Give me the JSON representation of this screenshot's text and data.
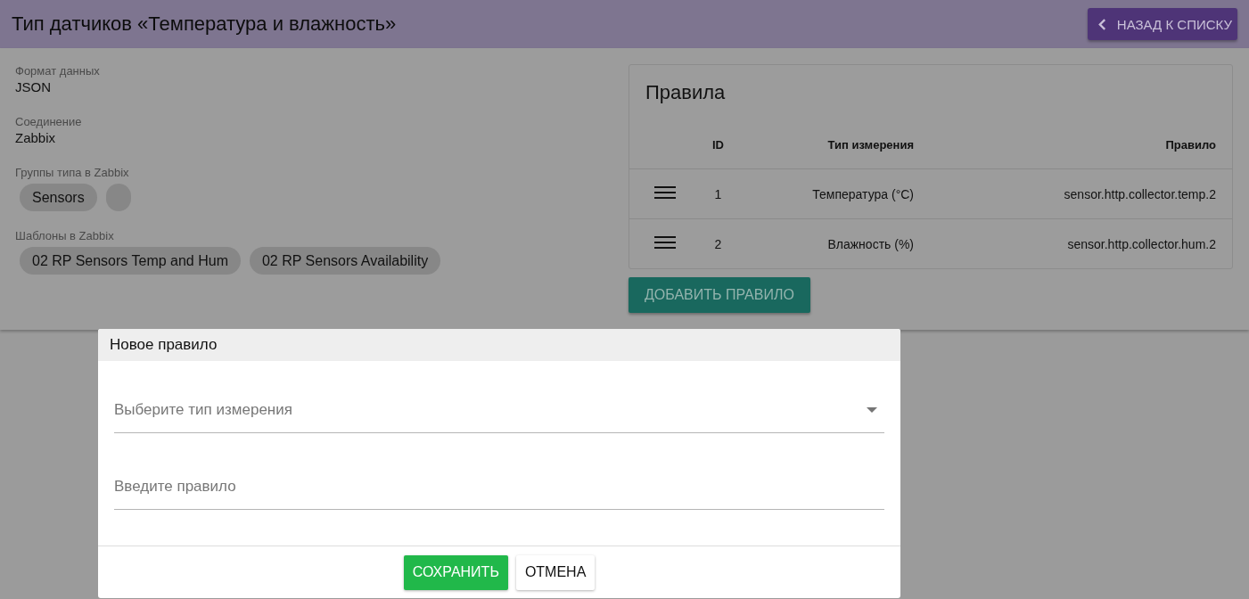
{
  "header": {
    "title": "Тип датчиков «Температура и влажность»",
    "back_button": "НАЗАД К СПИСКУ"
  },
  "details": [
    {
      "kind": "text",
      "label": "Формат данных",
      "value": "JSON"
    },
    {
      "kind": "text",
      "label": "Соединение",
      "value": "Zabbix"
    },
    {
      "kind": "chips",
      "label": "Группы типа в Zabbix",
      "chips": [
        {
          "kind": "text",
          "label": "Sensors"
        },
        {
          "kind": "blank"
        }
      ]
    },
    {
      "kind": "chips",
      "label": "Шаблоны в Zabbix",
      "chips": [
        {
          "kind": "text",
          "label": "02 RP Sensors Temp and Hum"
        },
        {
          "kind": "text",
          "label": "02 RP Sensors Availability"
        }
      ]
    }
  ],
  "rules": {
    "title": "Правила",
    "columns": [
      "ID",
      "Тип измерения",
      "Правило"
    ],
    "rows": [
      {
        "id": "1",
        "type": "Температура (°C)",
        "rule": "sensor.http.collector.temp.2"
      },
      {
        "id": "2",
        "type": "Влажность (%)",
        "rule": "sensor.http.collector.hum.2"
      }
    ],
    "add_button": "ДОБАВИТЬ ПРАВИЛО"
  },
  "dialog": {
    "title": "Новое правило",
    "fields": [
      {
        "kind": "select",
        "placeholder": "Выберите тип измерения"
      },
      {
        "kind": "input",
        "placeholder": "Введите правило"
      }
    ],
    "buttons": [
      {
        "kind": "primary",
        "label": "СОХРАНИТЬ"
      },
      {
        "kind": "plain",
        "label": "ОТМЕНА"
      }
    ]
  }
}
